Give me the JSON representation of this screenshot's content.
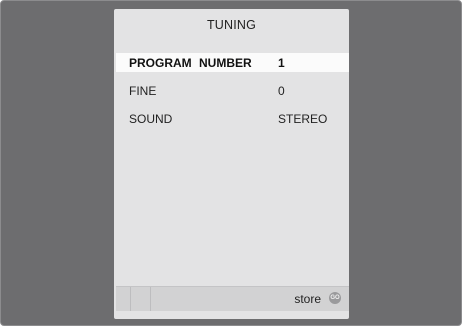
{
  "menu": {
    "title": "TUNING",
    "items": [
      {
        "label": "PROGRAM  NUMBER",
        "value": "1",
        "selected": true
      },
      {
        "label": "FINE",
        "value": "0",
        "selected": false
      },
      {
        "label": "SOUND",
        "value": "STEREO",
        "selected": false
      }
    ]
  },
  "footer": {
    "store_label": "store",
    "go_icon_text": "GO"
  },
  "colors": {
    "background": "#6d6d6f",
    "panel": "#e3e3e4",
    "selected_row": "#fbfbfb",
    "footer": "#d2d2d3",
    "go_button": "#9a9a9c"
  }
}
